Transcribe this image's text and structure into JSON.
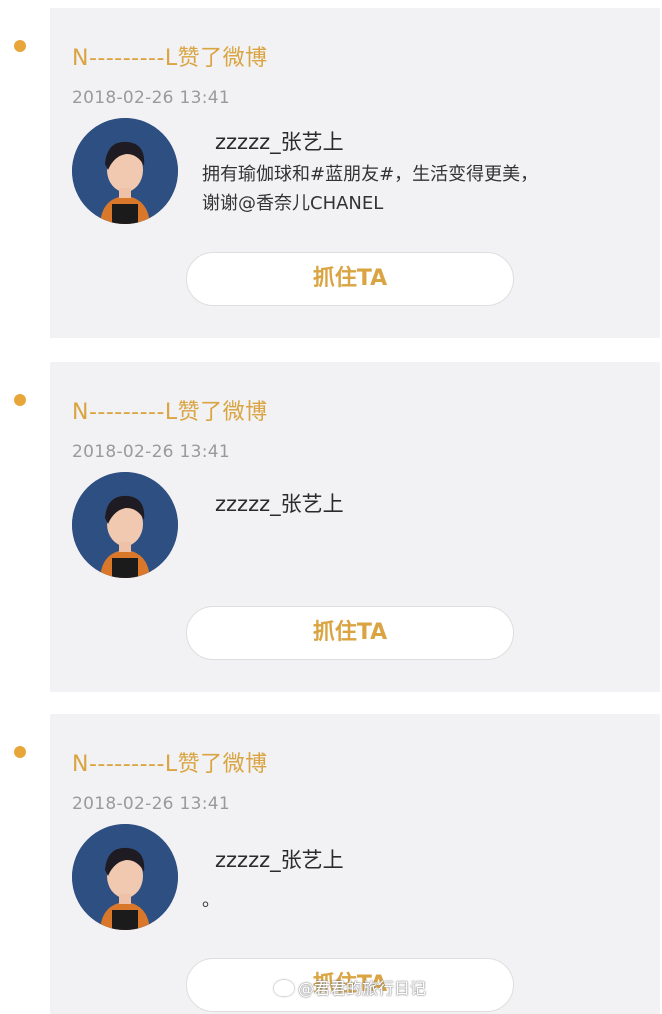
{
  "colors": {
    "accent": "#d9a441",
    "dot": "#e8a63a",
    "card_bg": "#f2f2f4",
    "time_text": "#9a9a9a"
  },
  "feed": [
    {
      "title": "N---------L赞了微博",
      "time": "2018-02-26 13:41",
      "user_name": "zzzzz_张艺上",
      "post_lines": [
        "拥有瑜伽球和#蓝朋友#，生活变得更美，",
        "谢谢@香奈儿CHANEL"
      ],
      "button_label": "抓住TA"
    },
    {
      "title": "N---------L赞了微博",
      "time": "2018-02-26 13:41",
      "user_name": "zzzzz_张艺上",
      "post_lines": [],
      "button_label": "抓住TA"
    },
    {
      "title": "N---------L赞了微博",
      "time": "2018-02-26 13:41",
      "user_name": "zzzzz_张艺上",
      "post_lines": [
        "。"
      ],
      "button_label": "抓住TA"
    }
  ],
  "watermark": "@君君的旅行日记"
}
